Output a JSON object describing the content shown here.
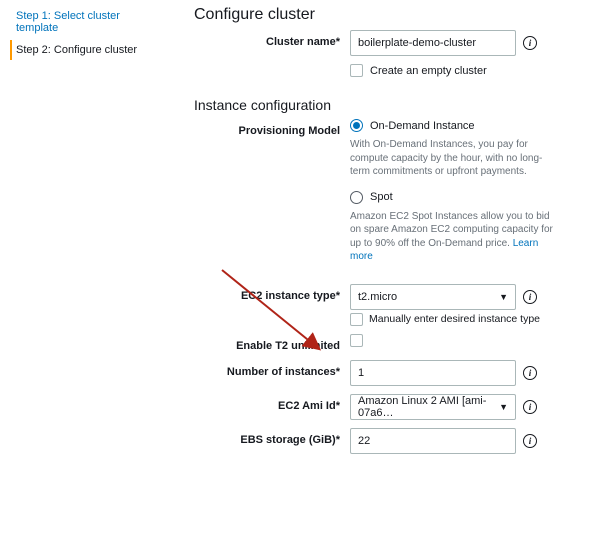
{
  "sidebar": {
    "step1": "Step 1: Select cluster template",
    "step2": "Step 2: Configure cluster"
  },
  "page": {
    "title": "Configure cluster",
    "section_instance": "Instance configuration"
  },
  "labels": {
    "cluster_name": "Cluster name*",
    "provisioning_model": "Provisioning Model",
    "ec2_instance_type": "EC2 instance type*",
    "enable_t2_unlimited": "Enable T2 unlimited",
    "number_of_instances": "Number of instances*",
    "ec2_ami_id": "EC2 Ami Id*",
    "ebs_storage": "EBS storage (GiB)*"
  },
  "values": {
    "cluster_name": "boilerplate-demo-cluster",
    "empty_cluster_label": "Create an empty cluster",
    "on_demand_label": "On-Demand Instance",
    "on_demand_help": "With On-Demand Instances, you pay for compute capacity by the hour, with no long-term commitments or upfront payments.",
    "spot_label": "Spot",
    "spot_help": "Amazon EC2 Spot Instances allow you to bid on spare Amazon EC2 computing capacity for up to 90% off the On-Demand price. ",
    "learn_more": "Learn more",
    "ec2_instance_type": "t2.micro",
    "manual_instance_label": "Manually enter desired instance type",
    "number_of_instances": "1",
    "ec2_ami_id": "Amazon Linux 2 AMI [ami-07a6…",
    "ebs_storage": "22"
  }
}
